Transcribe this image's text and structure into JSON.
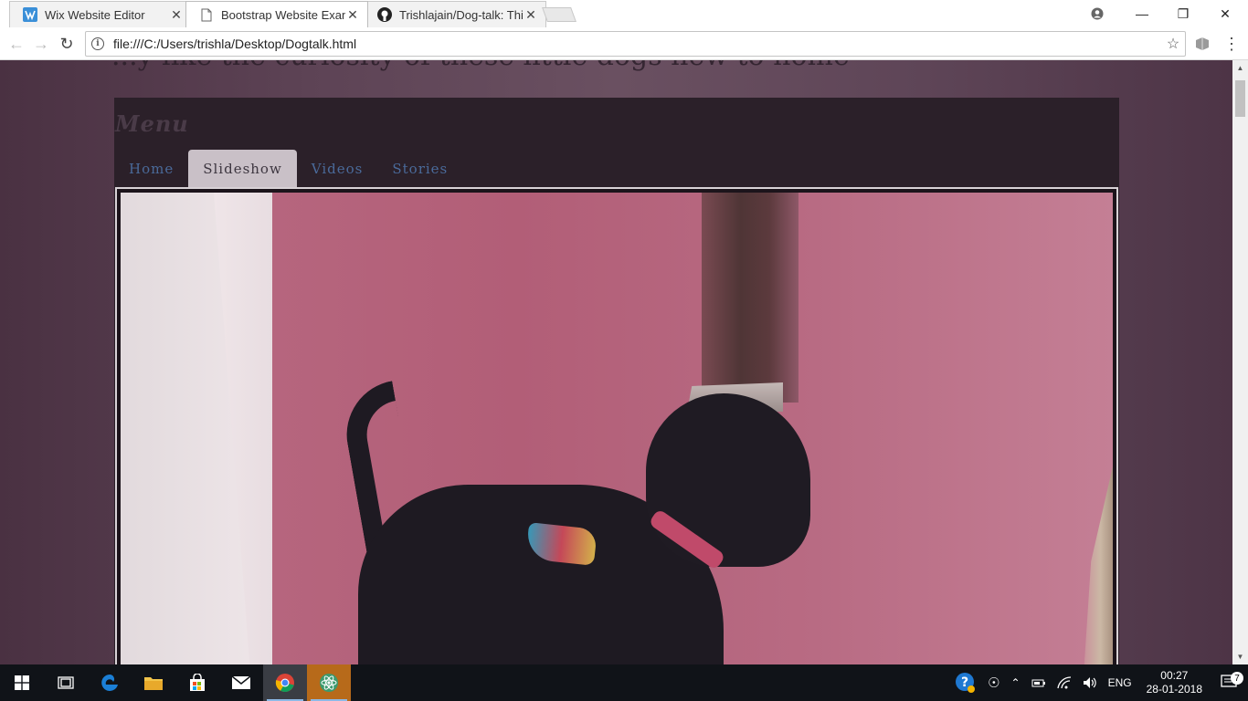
{
  "browser": {
    "tabs": [
      {
        "title": "Wix Website Editor",
        "active": false
      },
      {
        "title": "Bootstrap Website Examp",
        "active": true
      },
      {
        "title": "Trishlajain/Dog-talk: This",
        "active": false
      }
    ],
    "close_glyph": "✕",
    "url": "file:///C:/Users/trishla/Desktop/Dogtalk.html",
    "window_controls": [
      "—",
      "❐",
      "✕"
    ]
  },
  "page": {
    "heading_fragment": "...y like the curiosity of these little dogs new to home",
    "menu_title": "Menu",
    "nav": [
      {
        "label": "Home",
        "active": false
      },
      {
        "label": "Slideshow",
        "active": true
      },
      {
        "label": "Videos",
        "active": false
      },
      {
        "label": "Stories",
        "active": false
      }
    ]
  },
  "taskbar": {
    "tray_language": "ENG",
    "clock_time": "00:27",
    "clock_date": "28-01-2018",
    "notification_count": "7"
  },
  "colors": {
    "accent": "#4a6a9a",
    "menu_bg": "#2b2029",
    "active_tab_bg": "#c9c0c7"
  }
}
